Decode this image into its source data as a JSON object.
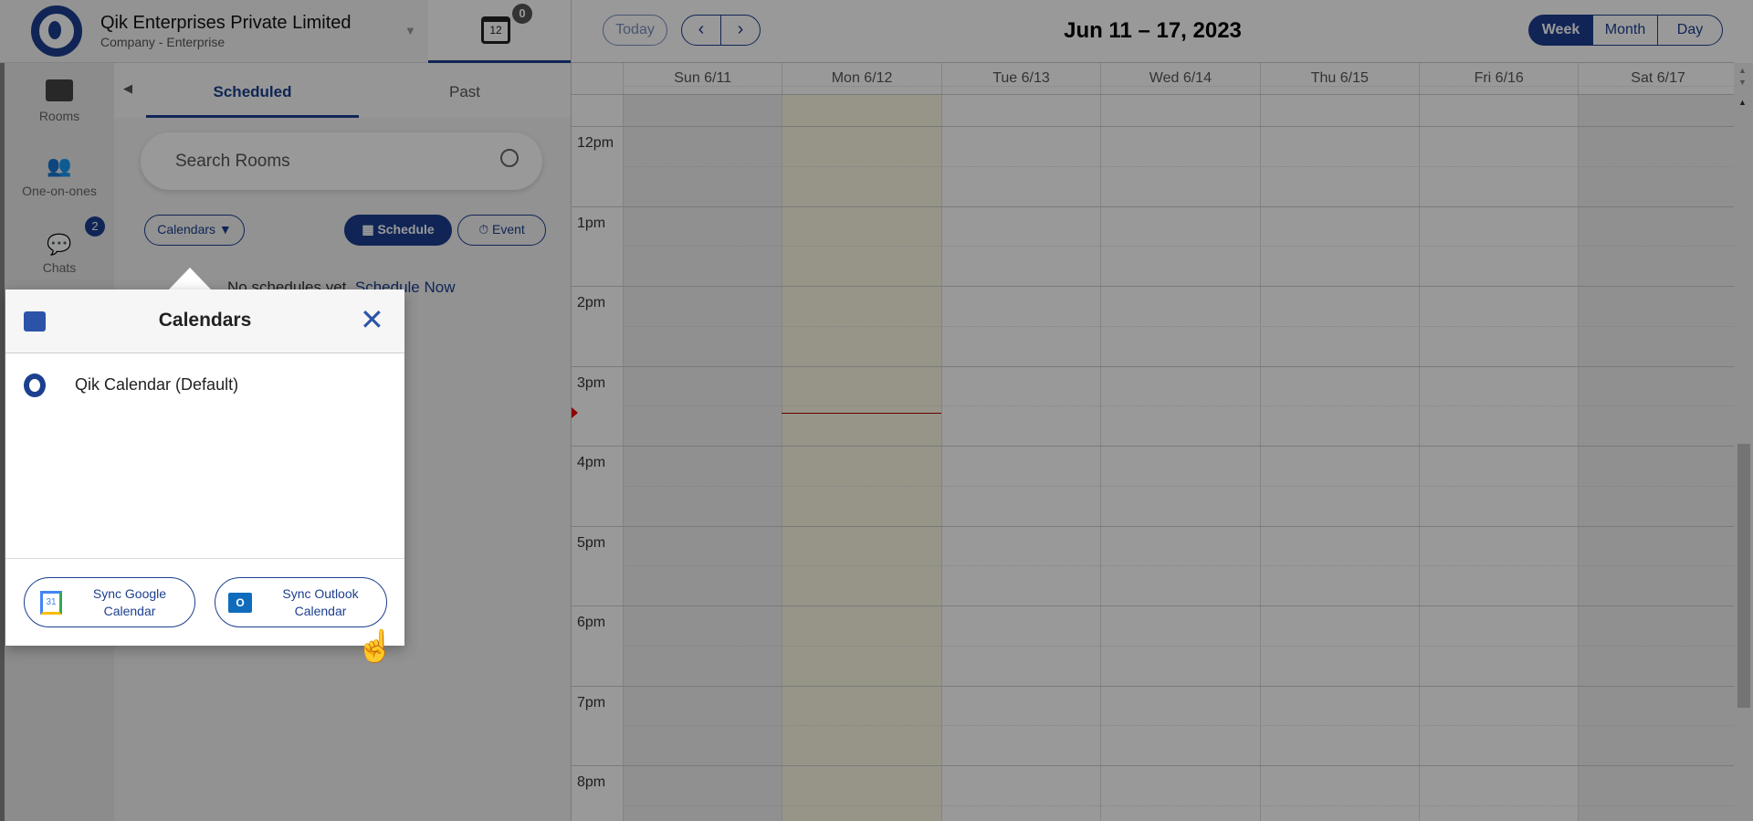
{
  "header": {
    "org_name": "Qik Enterprises Private Limited",
    "org_type": "Company - Enterprise",
    "calendar_icon_day": "12",
    "calendar_badge": "0"
  },
  "sidebar": {
    "items": [
      {
        "label": "Rooms",
        "icon": "rooms-icon"
      },
      {
        "label": "One-on-ones",
        "icon": "people-icon"
      },
      {
        "label": "Chats",
        "icon": "chat-icon",
        "badge": "2"
      }
    ]
  },
  "panel": {
    "tabs": [
      {
        "label": "Scheduled",
        "active": true
      },
      {
        "label": "Past",
        "active": false
      }
    ],
    "search_placeholder": "Search Rooms",
    "calendars_button": "Calendars ▼",
    "schedule_button": "Schedule",
    "event_button": "Event",
    "empty_text": "No schedules yet.",
    "schedule_now_link": "Schedule Now"
  },
  "calendar": {
    "today_button": "Today",
    "prev": "‹",
    "next": "›",
    "title": "Jun 11 – 17, 2023",
    "views": [
      {
        "label": "Week",
        "active": true
      },
      {
        "label": "Month",
        "active": false
      },
      {
        "label": "Day",
        "active": false
      }
    ],
    "days": [
      "Sun 6/11",
      "Mon 6/12",
      "Tue 6/13",
      "Wed 6/14",
      "Thu 6/15",
      "Fri 6/16",
      "Sat 6/17"
    ],
    "today_index": 1,
    "hours": [
      "12pm",
      "1pm",
      "2pm",
      "3pm",
      "4pm",
      "5pm",
      "6pm",
      "7pm",
      "8pm"
    ],
    "current_time_approx": "3:35pm",
    "today_color": "#fcf8e3"
  },
  "popup": {
    "title": "Calendars",
    "calendars": [
      {
        "name": "Qik Calendar (Default)"
      }
    ],
    "sync_google": "Sync Google Calendar",
    "sync_outlook": "Sync Outlook Calendar"
  },
  "colors": {
    "brand": "#1c3f8f"
  }
}
